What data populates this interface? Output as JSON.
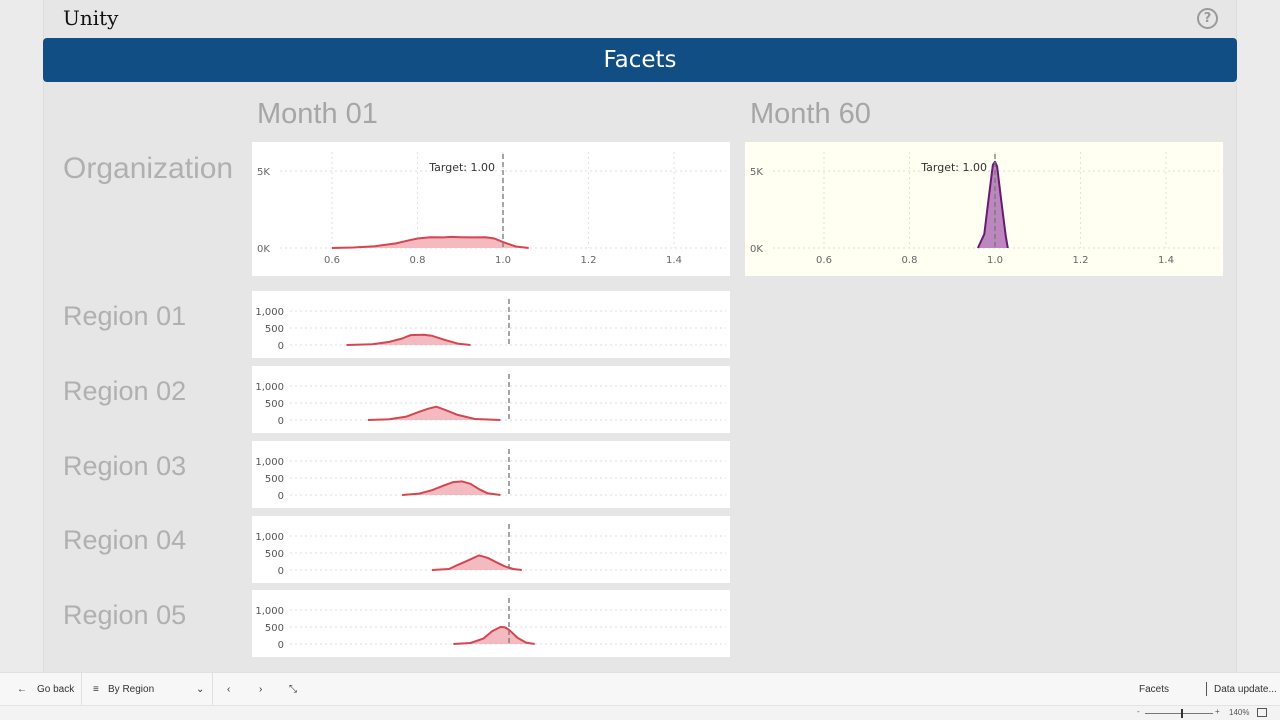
{
  "app": {
    "logo": "Unity",
    "help_icon": "question-circle-icon"
  },
  "banner": {
    "title": "Facets"
  },
  "columns": [
    "Month 01",
    "Month 60"
  ],
  "rows": [
    "Organization",
    "Region 01",
    "Region 02",
    "Region 03",
    "Region 04",
    "Region 05"
  ],
  "colors": {
    "banner": "#114e84",
    "month01_line": "#d64550",
    "month01_fill": "#f2b3b9",
    "month60_line": "#6a1b6e",
    "month60_fill": "#b57ab8",
    "month60_bg": "#fffff2"
  },
  "chart_data": [
    {
      "type": "area",
      "x_ticks": [
        "0.6",
        "0.8",
        "1.0",
        "1.2",
        "1.4"
      ],
      "y_ticks": [
        "0K",
        "5K"
      ],
      "xlim": [
        0.6,
        1.4
      ],
      "ylim": [
        0,
        5000
      ],
      "target_label": "Target: 1.00",
      "target": 1.0,
      "x": [
        0.6,
        0.65,
        0.7,
        0.75,
        0.78,
        0.8,
        0.83,
        0.86,
        0.88,
        0.9,
        0.93,
        0.96,
        0.98,
        1.0,
        1.03,
        1.06
      ],
      "y": [
        0,
        30,
        120,
        300,
        500,
        620,
        700,
        690,
        720,
        700,
        690,
        700,
        620,
        380,
        100,
        0
      ]
    },
    {
      "type": "area",
      "x_ticks": [
        "0.6",
        "0.8",
        "1.0",
        "1.2",
        "1.4"
      ],
      "y_ticks": [
        "0K",
        "5K"
      ],
      "xlim": [
        0.6,
        1.4
      ],
      "ylim": [
        0,
        5000
      ],
      "target_label": "Target: 1.00",
      "target": 1.0,
      "x": [
        0.96,
        0.975,
        0.985,
        0.995,
        1.0,
        1.005,
        1.015,
        1.025,
        1.03
      ],
      "y": [
        0,
        900,
        3200,
        5400,
        5600,
        5300,
        3000,
        800,
        0
      ]
    },
    {
      "type": "area",
      "y_ticks": [
        "0",
        "500",
        "1,000"
      ],
      "ylim": [
        0,
        1000
      ],
      "target": 1.0,
      "x": [
        0.62,
        0.68,
        0.72,
        0.75,
        0.77,
        0.8,
        0.82,
        0.85,
        0.88,
        0.91
      ],
      "y": [
        0,
        20,
        90,
        190,
        290,
        300,
        270,
        150,
        40,
        0
      ]
    },
    {
      "type": "area",
      "y_ticks": [
        "0",
        "500",
        "1,000"
      ],
      "ylim": [
        0,
        1000
      ],
      "target": 1.0,
      "x": [
        0.67,
        0.72,
        0.76,
        0.79,
        0.81,
        0.83,
        0.85,
        0.88,
        0.92,
        0.98
      ],
      "y": [
        0,
        20,
        100,
        240,
        330,
        390,
        300,
        150,
        30,
        0
      ]
    },
    {
      "type": "area",
      "y_ticks": [
        "0",
        "500",
        "1,000"
      ],
      "ylim": [
        0,
        1000
      ],
      "target": 1.0,
      "x": [
        0.75,
        0.79,
        0.82,
        0.85,
        0.87,
        0.89,
        0.91,
        0.93,
        0.95,
        0.98
      ],
      "y": [
        0,
        40,
        140,
        290,
        380,
        400,
        330,
        170,
        50,
        0
      ]
    },
    {
      "type": "area",
      "y_ticks": [
        "0",
        "500",
        "1,000"
      ],
      "ylim": [
        0,
        1000
      ],
      "target": 1.0,
      "x": [
        0.82,
        0.86,
        0.88,
        0.9,
        0.93,
        0.95,
        0.97,
        0.99,
        1.01,
        1.03
      ],
      "y": [
        0,
        30,
        150,
        260,
        430,
        360,
        230,
        110,
        30,
        0
      ]
    },
    {
      "type": "area",
      "y_ticks": [
        "0",
        "500",
        "1,000"
      ],
      "ylim": [
        0,
        1000
      ],
      "target": 1.0,
      "x": [
        0.87,
        0.91,
        0.94,
        0.96,
        0.98,
        0.99,
        1.0,
        1.02,
        1.04,
        1.06
      ],
      "y": [
        0,
        30,
        160,
        370,
        500,
        490,
        420,
        180,
        40,
        0
      ]
    }
  ],
  "footer": {
    "go_back": "Go back",
    "bookmark": "By Region",
    "page_name": "Facets",
    "data_update": "Data update...",
    "zoom": "140%"
  }
}
